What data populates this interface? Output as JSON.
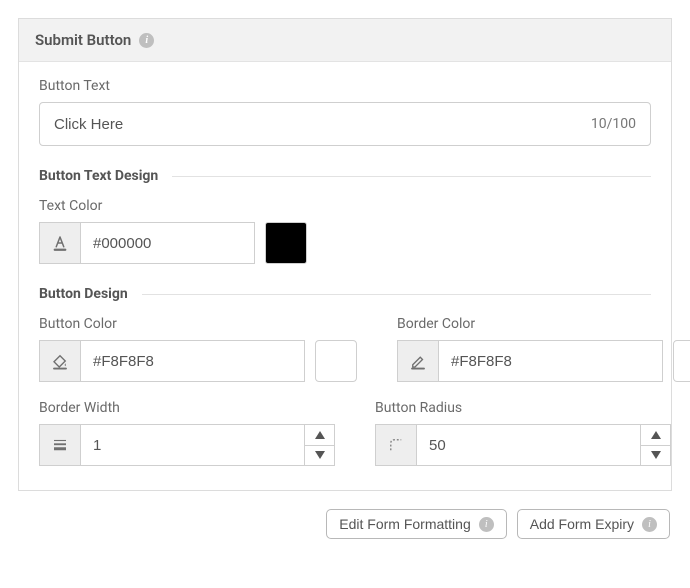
{
  "panel": {
    "title": "Submit Button"
  },
  "buttonText": {
    "label": "Button Text",
    "value": "Click Here",
    "counter": "10/100"
  },
  "sections": {
    "textDesign": "Button Text Design",
    "buttonDesign": "Button Design"
  },
  "textColor": {
    "label": "Text Color",
    "value": "#000000",
    "swatch": "#000000"
  },
  "buttonColor": {
    "label": "Button Color",
    "value": "#F8F8F8",
    "swatch": "#ffffff"
  },
  "borderColor": {
    "label": "Border Color",
    "value": "#F8F8F8",
    "swatch": "#ffffff"
  },
  "borderWidth": {
    "label": "Border Width",
    "value": "1"
  },
  "buttonRadius": {
    "label": "Button Radius",
    "value": "50"
  },
  "footer": {
    "edit": "Edit Form Formatting",
    "expiry": "Add Form Expiry"
  }
}
